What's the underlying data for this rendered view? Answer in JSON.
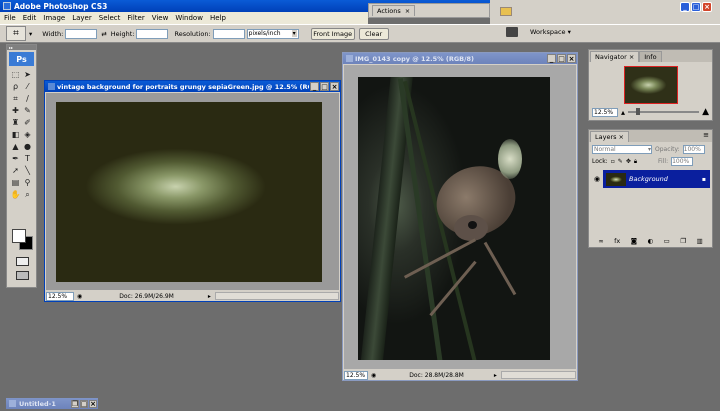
{
  "app": {
    "title": "Adobe Photoshop CS3"
  },
  "menu": [
    "File",
    "Edit",
    "Image",
    "Layer",
    "Select",
    "Filter",
    "View",
    "Window",
    "Help"
  ],
  "options": {
    "width_label": "Width:",
    "height_label": "Height:",
    "resolution_label": "Resolution:",
    "units": "pixels/inch",
    "front_image": "Front Image",
    "clear": "Clear",
    "workspace": "Workspace ▾"
  },
  "actions_tab": {
    "label": "Actions"
  },
  "tools_badge": "Ps",
  "toolbox_header": "▸▸",
  "doc1": {
    "title": "vintage background for portraits grungy sepiaGreen.jpg @ 12.5% (RGB/8)",
    "zoom": "12.5%",
    "doc": "Doc: 26.9M/26.9M"
  },
  "doc2": {
    "title": "IMG_0143 copy @ 12.5% (RGB/8)",
    "zoom": "12.5%",
    "doc": "Doc: 28.8M/28.8M"
  },
  "navigator": {
    "tab": "Navigator",
    "info_tab": "Info",
    "zoom": "12.5%"
  },
  "layers": {
    "tab": "Layers",
    "blend": "Normal",
    "opacity_label": "Opacity:",
    "opacity": "100%",
    "lock_label": "Lock:",
    "fill_label": "Fill:",
    "fill": "100%",
    "layer_name": "Background"
  },
  "minimized": {
    "title": "Untitled-1"
  },
  "icons": [
    "crop-icon",
    "move-icon",
    "marquee-icon",
    "lasso-icon",
    "magic-wand-icon",
    "brush-icon",
    "eraser-icon",
    "pen-icon",
    "type-icon",
    "hand-icon",
    "zoom-icon",
    "eye-icon",
    "lock-icon"
  ]
}
